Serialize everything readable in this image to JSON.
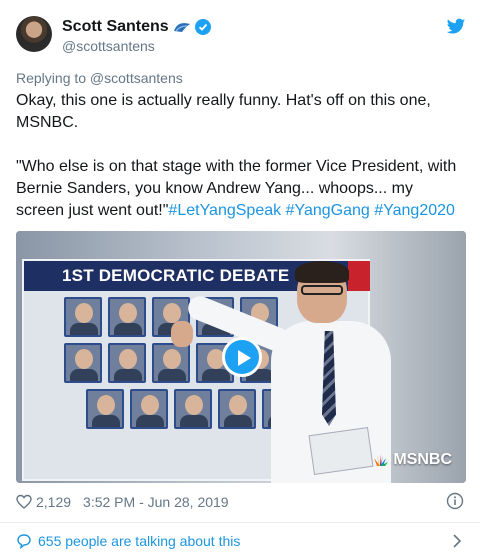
{
  "author": {
    "name": "Scott Santens",
    "handle": "@scottsantens"
  },
  "icons": {
    "avatar": "user-avatar",
    "emoji": "blue-wave-emoji-icon",
    "verified": "verified-badge-icon",
    "twitter": "twitter-bird-icon",
    "play": "play-icon",
    "like": "heart-icon",
    "info": "info-icon",
    "comment": "comment-icon",
    "chevron": "chevron-right-icon"
  },
  "colors": {
    "accent": "#1da1f2",
    "link": "#1b95e0",
    "muted": "#657786",
    "text": "#14171a"
  },
  "tweet": {
    "replying_to": "Replying to @scottsantens",
    "paragraph1": "Okay, this one is actually really funny. Hat's off on this one, MSNBC.",
    "quote": "\"Who else is on that stage with the former Vice President, with Bernie Sanders, you know Andrew Yang... whoops... my screen just went out!\"",
    "hashtags": [
      "#LetYangSpeak",
      "#YangGang",
      "#Yang2020"
    ]
  },
  "media": {
    "screen_title": "1ST DEMOCRATIC DEBATE QU",
    "network_logo": "MSNBC"
  },
  "footer": {
    "likes": "2,129",
    "timestamp": "3:52 PM - Jun 28, 2019",
    "talking": "655 people are talking about this"
  }
}
